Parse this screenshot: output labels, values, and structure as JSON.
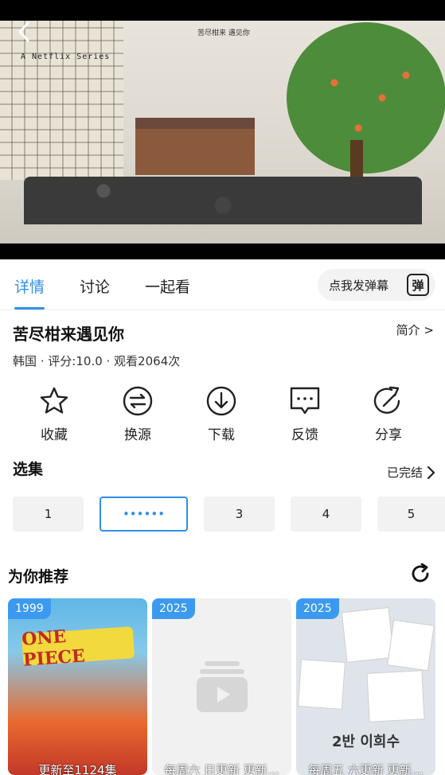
{
  "video": {
    "watermark": "A Netflix Series",
    "title_logo": "苦尽柑来 遇见你"
  },
  "tabs": [
    {
      "label": "详情",
      "active": true
    },
    {
      "label": "讨论",
      "active": false
    },
    {
      "label": "一起看",
      "active": false
    }
  ],
  "danmu": {
    "label": "点我发弹幕",
    "icon_text": "弹"
  },
  "show": {
    "title": "苦尽柑来遇见你",
    "intro_link": "简介 >",
    "meta": "韩国 · 评分:10.0 · 观看2064次"
  },
  "actions": [
    {
      "label": "收藏",
      "icon": "star-icon"
    },
    {
      "label": "换源",
      "icon": "switch-source-icon"
    },
    {
      "label": "下载",
      "icon": "download-icon"
    },
    {
      "label": "反馈",
      "icon": "feedback-icon"
    },
    {
      "label": "分享",
      "icon": "share-icon"
    }
  ],
  "episodes": {
    "section_title": "选集",
    "status": "已完结",
    "items": [
      "1",
      "••••••",
      "3",
      "4",
      "5"
    ],
    "selected_index": 1
  },
  "recommend": {
    "section_title": "为你推荐",
    "cards": [
      {
        "year": "1999",
        "caption": "更新至1124集",
        "poster_text": "ONE PIECE"
      },
      {
        "year": "2025",
        "caption": "每周六 日更新 更新…"
      },
      {
        "year": "2025",
        "caption": "每周五 六更新 更新…",
        "poster_text": "2반 이희수"
      }
    ]
  },
  "colors": {
    "accent": "#2f8fe8",
    "badge": "#3b9af0"
  }
}
